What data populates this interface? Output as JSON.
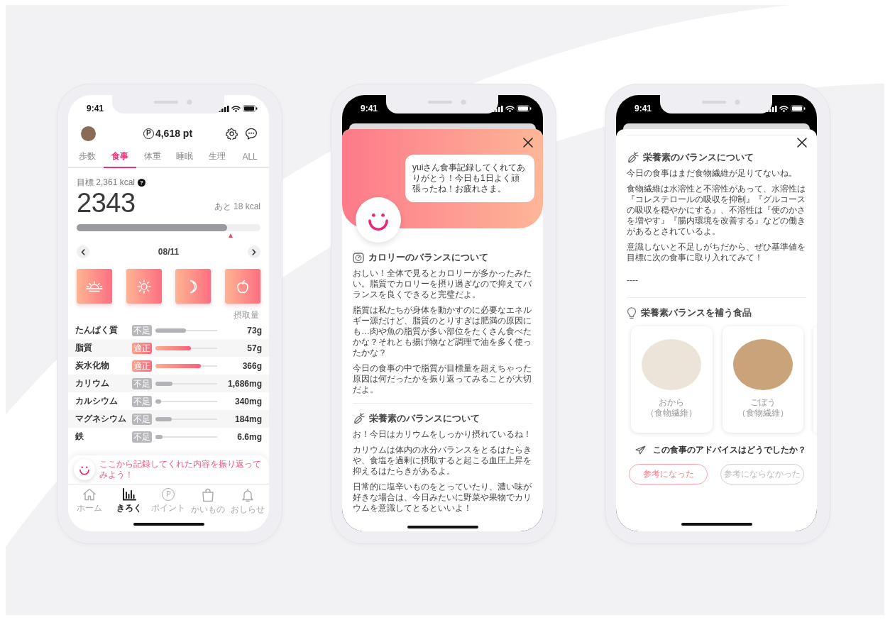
{
  "phones": [
    {
      "kind": "record",
      "status_bar": {
        "time": "9:41"
      },
      "header": {
        "symbol": "P",
        "points": "4,618 pt"
      },
      "tabs": [
        {
          "label": "歩数",
          "selected": false
        },
        {
          "label": "食事",
          "selected": true
        },
        {
          "label": "体重",
          "selected": false
        },
        {
          "label": "睡眠",
          "selected": false
        },
        {
          "label": "生理",
          "selected": false
        },
        {
          "label": "ALL",
          "selected": false
        }
      ],
      "calories": {
        "goal": "目標 2,361 kcal",
        "help": "?",
        "value": "2343",
        "remaining": "あと 18 kcal",
        "level": 0.82
      },
      "date_nav": {
        "date": "08/11"
      },
      "meals": [
        {
          "kind": "breakfast"
        },
        {
          "kind": "lunch"
        },
        {
          "kind": "dinner"
        },
        {
          "kind": "snack"
        }
      ],
      "intake_label": "摂取量",
      "nutrients": [
        {
          "name": "たんぱく質",
          "kind": "short",
          "status": "不足",
          "level": 0.49,
          "amount": "73g"
        },
        {
          "name": "脂質",
          "kind": "ok",
          "status": "適正",
          "level": 0.57,
          "amount": "57g"
        },
        {
          "name": "炭水化物",
          "kind": "ok",
          "status": "適正",
          "level": 0.73,
          "amount": "366g"
        },
        {
          "name": "カリウム",
          "kind": "short",
          "status": "不足",
          "level": 0.28,
          "amount": "1,686mg"
        },
        {
          "name": "カルシウム",
          "kind": "short",
          "status": "不足",
          "level": 0.09,
          "amount": "340mg"
        },
        {
          "name": "マグネシウム",
          "kind": "short",
          "status": "不足",
          "level": 0.26,
          "amount": "184mg"
        },
        {
          "name": "鉄",
          "kind": "short",
          "status": "不足",
          "level": 0.11,
          "amount": "6.6mg"
        }
      ],
      "banner": {
        "text": "ここから記録してくれた内容を振り返ってみよう！"
      },
      "nav": [
        {
          "kind": "home",
          "label": "ホーム",
          "selected": false
        },
        {
          "kind": "record",
          "label": "きろく",
          "selected": true
        },
        {
          "kind": "points",
          "symbol": "P",
          "label": "ポイント",
          "selected": false
        },
        {
          "kind": "shop",
          "label": "かいもの",
          "selected": false
        },
        {
          "kind": "notice",
          "label": "おしらせ",
          "selected": false
        }
      ]
    },
    {
      "kind": "advice",
      "status_bar": {
        "time": "9:41"
      },
      "greeting": {
        "message": "yuiさん食事記録してくれてありがとう！今日も1日よく頑張ったね！お疲れさま。"
      },
      "sections": [
        {
          "kind": "calorie",
          "title": "カロリーのバランスについて",
          "paragraphs": [
            "おしい！全体で見るとカロリーが多かったみたい。脂質でカロリーを摂り過ぎなので抑えてバランスを良くできると完璧だよ。",
            "脂質は私たちが身体を動かすのに必要なエネルギー源だけど、脂質のとりすぎは肥満の原因にも…肉や魚の脂質が多い部位をたくさん食べたかな？それとも揚げ物など調理で油を多く使ったかな？",
            "今日の食事の中で脂質が目標量を超えちゃった原因は何だったかを振り返ってみることが大切だよ。"
          ]
        },
        {
          "kind": "nutrient",
          "title": "栄養素のバランスについて",
          "paragraphs": [
            "お！今日はカリウムをしっかり摂れているね！",
            "カリウムは体内の水分バランスをとるはたらきや、食塩を過剰に摂取すると起こる血圧上昇を抑えるはたらきがあるよ。",
            "日常的に塩辛いものをとっていたり、濃い味が好きな場合は、今日みたいに野菜や果物でカリウムを意識してとるといいよ！"
          ]
        }
      ]
    },
    {
      "kind": "advice",
      "status_bar": {
        "time": "9:41"
      },
      "sections": [
        {
          "kind": "nutrient",
          "title": "栄養素のバランスについて",
          "paragraphs": [
            "今日の食事はまだ食物繊維が足りてないね。",
            "食物繊維は水溶性と不溶性があって、水溶性は『コレステロールの吸収を抑制』『グルコースの吸収を穏やかにする』、不溶性は『便のかさを増やす』『腸内環境を改善する』などの働きがあるとされているよ。",
            "意識しないと不足しがちだから、ぜひ基準値を目標に次の食事に取り入れてみて！"
          ],
          "separator": "----"
        },
        {
          "kind": "foods",
          "title": "栄養素バランスを補う食品",
          "foods": [
            {
              "name": "おから",
              "category": "（食物繊維）"
            },
            {
              "name": "ごぼう",
              "category": "（食物繊維）"
            }
          ]
        }
      ],
      "feedback": {
        "question": "この食事のアドバイスはどうでしたか？",
        "buttons": [
          {
            "kind": "positive",
            "label": "参考になった"
          },
          {
            "kind": "negative",
            "label": "参考にならなかった"
          }
        ]
      }
    }
  ]
}
